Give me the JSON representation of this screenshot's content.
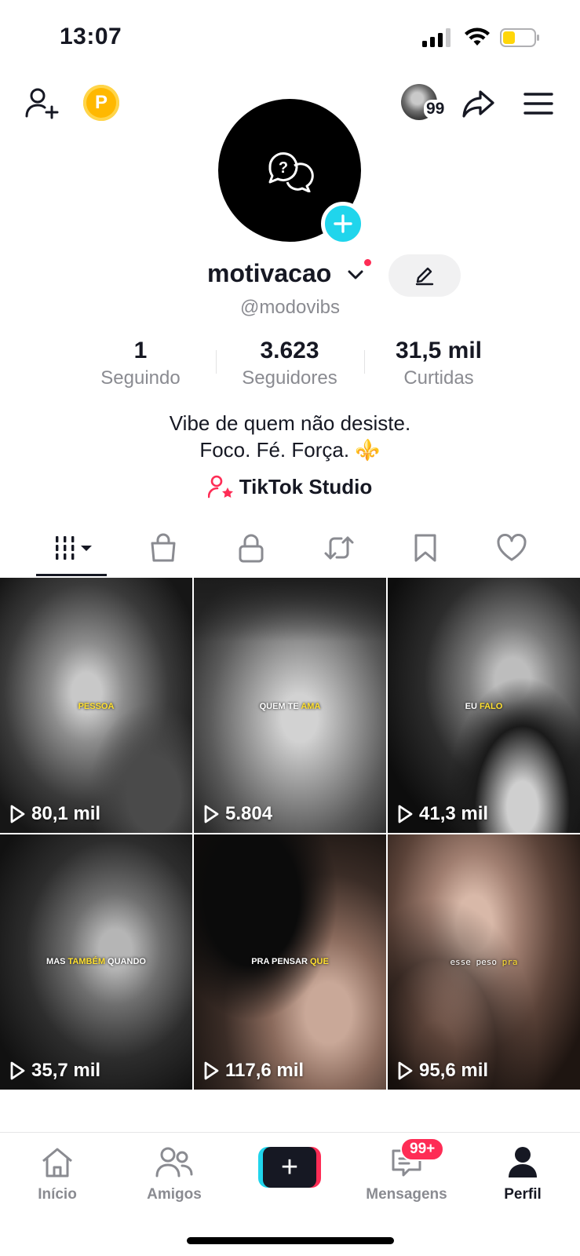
{
  "status_bar": {
    "time": "13:07"
  },
  "top_bar": {
    "coin_label": "P",
    "friends_badge": "99"
  },
  "profile": {
    "display_name": "motivacao",
    "username": "@modovibs",
    "bio_line1": "Vibe de quem não desiste.",
    "bio_line2": "Foco. Fé. Força. ⚜️",
    "studio_label": "TikTok Studio"
  },
  "stats": [
    {
      "value": "1",
      "label": "Seguindo"
    },
    {
      "value": "3.623",
      "label": "Seguidores"
    },
    {
      "value": "31,5 mil",
      "label": "Curtidas"
    }
  ],
  "tabs": [
    {
      "icon": "grid-icon",
      "active": true
    },
    {
      "icon": "shopping-bag-icon"
    },
    {
      "icon": "lock-icon"
    },
    {
      "icon": "repost-icon"
    },
    {
      "icon": "bookmark-icon"
    },
    {
      "icon": "heart-icon"
    }
  ],
  "videos": [
    {
      "caption_parts": [
        "PESSOA"
      ],
      "highlight": [
        true
      ],
      "views": "80,1 mil"
    },
    {
      "caption_parts": [
        "QUEM TE ",
        "AMA"
      ],
      "highlight": [
        false,
        true
      ],
      "views": "5.804"
    },
    {
      "caption_parts": [
        "EU ",
        "FALO"
      ],
      "highlight": [
        false,
        true
      ],
      "views": "41,3 mil"
    },
    {
      "caption_parts": [
        "MAS ",
        "TAMBÉM",
        " QUANDO"
      ],
      "highlight": [
        false,
        true,
        false
      ],
      "views": "35,7 mil"
    },
    {
      "caption_parts": [
        "PRA PENSAR ",
        "QUE"
      ],
      "highlight": [
        false,
        true
      ],
      "views": "117,6 mil"
    },
    {
      "caption_parts": [
        "esse peso ",
        "pra"
      ],
      "highlight": [
        false,
        true
      ],
      "views": "95,6 mil"
    }
  ],
  "bottom_nav": {
    "home": "Início",
    "friends": "Amigos",
    "create": "+",
    "messages": "Mensagens",
    "messages_badge": "99+",
    "profile": "Perfil"
  },
  "colors": {
    "accent_pink": "#FE2C55",
    "accent_cyan": "#20D5EC",
    "coin": "#FFB800",
    "text_primary": "#161823",
    "text_secondary": "#8a8b91",
    "caption_highlight": "#FFE030"
  }
}
